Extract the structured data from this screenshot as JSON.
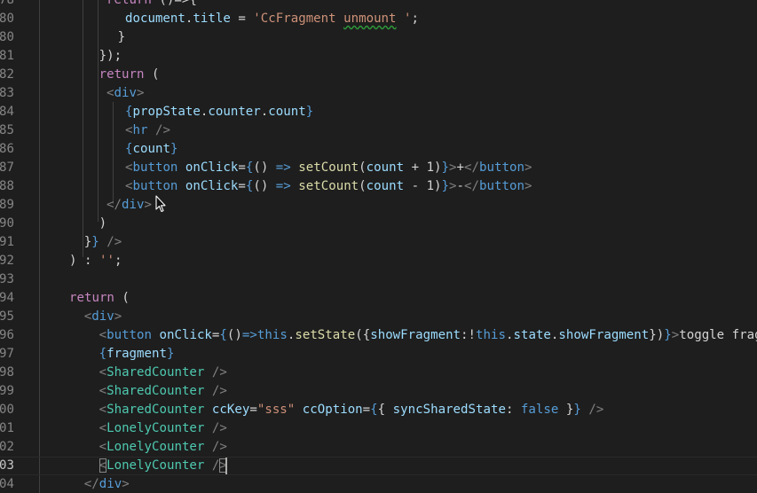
{
  "editor": {
    "theme_colors": {
      "background": "#1e1e1e",
      "line_number": "#858585",
      "keyword": "#c586c0",
      "tag": "#569cd6",
      "component": "#4ec9b0",
      "attribute": "#9cdcfe",
      "function": "#dcdcaa",
      "string": "#ce9178"
    },
    "current_line": "03",
    "lines": [
      {
        "n": "78",
        "indent": 2,
        "tokens": [
          [
            "kw",
            "return"
          ],
          [
            "plain",
            " ()=>{"
          ]
        ]
      },
      {
        "n": "80",
        "indent": 3,
        "tokens": [
          [
            "var",
            "document"
          ],
          [
            "plain",
            "."
          ],
          [
            "var",
            "title"
          ],
          [
            "plain",
            " = "
          ],
          [
            "str",
            "'CcFragment "
          ],
          [
            "str_sq",
            "unmount"
          ],
          [
            "str",
            " '"
          ],
          [
            "plain",
            ";"
          ]
        ]
      },
      {
        "n": "80",
        "indent": 2.6,
        "tokens": [
          [
            "plain",
            "}"
          ]
        ]
      },
      {
        "n": "81",
        "indent": 1.6,
        "tokens": [
          [
            "plain",
            "});"
          ]
        ]
      },
      {
        "n": "82",
        "indent": 1.6,
        "tokens": [
          [
            "kw",
            "return"
          ],
          [
            "plain",
            " ("
          ]
        ]
      },
      {
        "n": "83",
        "indent": 2,
        "tokens": [
          [
            "punct",
            "<"
          ],
          [
            "tag",
            "div"
          ],
          [
            "punct",
            ">"
          ]
        ]
      },
      {
        "n": "84",
        "indent": 3,
        "tokens": [
          [
            "brace",
            "{"
          ],
          [
            "var",
            "propState"
          ],
          [
            "plain",
            "."
          ],
          [
            "var",
            "counter"
          ],
          [
            "plain",
            "."
          ],
          [
            "var",
            "count"
          ],
          [
            "brace",
            "}"
          ]
        ]
      },
      {
        "n": "85",
        "indent": 3,
        "tokens": [
          [
            "punct",
            "<"
          ],
          [
            "tag",
            "hr"
          ],
          [
            "plain",
            " "
          ],
          [
            "punct",
            "/>"
          ]
        ]
      },
      {
        "n": "86",
        "indent": 3,
        "tokens": [
          [
            "brace",
            "{"
          ],
          [
            "var",
            "count"
          ],
          [
            "brace",
            "}"
          ]
        ]
      },
      {
        "n": "87",
        "indent": 3,
        "tokens": [
          [
            "punct",
            "<"
          ],
          [
            "tag",
            "button"
          ],
          [
            "plain",
            " "
          ],
          [
            "attr",
            "onClick"
          ],
          [
            "plain",
            "="
          ],
          [
            "brace",
            "{"
          ],
          [
            "plain",
            "() "
          ],
          [
            "tag",
            "=>"
          ],
          [
            "plain",
            " "
          ],
          [
            "func",
            "setCount"
          ],
          [
            "plain",
            "("
          ],
          [
            "var",
            "count"
          ],
          [
            "plain",
            " + 1)"
          ],
          [
            "brace",
            "}"
          ],
          [
            "punct",
            ">"
          ],
          [
            "plain",
            "+"
          ],
          [
            "punct",
            "</"
          ],
          [
            "tag",
            "button"
          ],
          [
            "punct",
            ">"
          ]
        ]
      },
      {
        "n": "88",
        "indent": 3,
        "tokens": [
          [
            "punct",
            "<"
          ],
          [
            "tag",
            "button"
          ],
          [
            "plain",
            " "
          ],
          [
            "attr",
            "onClick"
          ],
          [
            "plain",
            "="
          ],
          [
            "brace",
            "{"
          ],
          [
            "plain",
            "() "
          ],
          [
            "tag",
            "=>"
          ],
          [
            "plain",
            " "
          ],
          [
            "func",
            "setCount"
          ],
          [
            "plain",
            "("
          ],
          [
            "var",
            "count"
          ],
          [
            "plain",
            " - 1)"
          ],
          [
            "brace",
            "}"
          ],
          [
            "punct",
            ">"
          ],
          [
            "plain",
            "-"
          ],
          [
            "punct",
            "</"
          ],
          [
            "tag",
            "button"
          ],
          [
            "punct",
            ">"
          ]
        ]
      },
      {
        "n": "89",
        "indent": 2,
        "tokens": [
          [
            "punct",
            "</"
          ],
          [
            "tag",
            "div"
          ],
          [
            "punct",
            ">"
          ]
        ]
      },
      {
        "n": "90",
        "indent": 1.6,
        "tokens": [
          [
            "plain",
            ")"
          ]
        ]
      },
      {
        "n": "91",
        "indent": 0.8,
        "tokens": [
          [
            "plain",
            "}"
          ],
          [
            "brace",
            "}"
          ],
          [
            "plain",
            " "
          ],
          [
            "punct",
            "/>"
          ]
        ]
      },
      {
        "n": "92",
        "indent": 0,
        "tokens": [
          [
            "plain",
            ") : "
          ],
          [
            "str",
            "''"
          ],
          [
            "plain",
            ";"
          ]
        ]
      },
      {
        "n": "93",
        "indent": 0,
        "tokens": []
      },
      {
        "n": "94",
        "indent": 0,
        "tokens": [
          [
            "kw",
            "return"
          ],
          [
            "plain",
            " ("
          ]
        ]
      },
      {
        "n": "95",
        "indent": 0.8,
        "tokens": [
          [
            "punct",
            "<"
          ],
          [
            "tag",
            "div"
          ],
          [
            "punct",
            ">"
          ]
        ]
      },
      {
        "n": "96",
        "indent": 1.6,
        "tokens": [
          [
            "punct",
            "<"
          ],
          [
            "tag",
            "button"
          ],
          [
            "plain",
            " "
          ],
          [
            "attr",
            "onClick"
          ],
          [
            "plain",
            "="
          ],
          [
            "brace",
            "{"
          ],
          [
            "plain",
            "()"
          ],
          [
            "tag",
            "=>"
          ],
          [
            "this",
            "this"
          ],
          [
            "plain",
            "."
          ],
          [
            "func",
            "setState"
          ],
          [
            "plain",
            "({"
          ],
          [
            "var",
            "showFragment"
          ],
          [
            "plain",
            ":!"
          ],
          [
            "this",
            "this"
          ],
          [
            "plain",
            "."
          ],
          [
            "var",
            "state"
          ],
          [
            "plain",
            "."
          ],
          [
            "var",
            "showFragment"
          ],
          [
            "plain",
            "})"
          ],
          [
            "brace",
            "}"
          ],
          [
            "punct",
            ">"
          ],
          [
            "plain",
            "toggle fragment"
          ]
        ]
      },
      {
        "n": "97",
        "indent": 1.6,
        "tokens": [
          [
            "brace",
            "{"
          ],
          [
            "var",
            "fragment"
          ],
          [
            "brace",
            "}"
          ]
        ]
      },
      {
        "n": "98",
        "indent": 1.6,
        "tokens": [
          [
            "punct",
            "<"
          ],
          [
            "comp",
            "SharedCounter"
          ],
          [
            "plain",
            " "
          ],
          [
            "punct",
            "/>"
          ]
        ]
      },
      {
        "n": "99",
        "indent": 1.6,
        "tokens": [
          [
            "punct",
            "<"
          ],
          [
            "comp",
            "SharedCounter"
          ],
          [
            "plain",
            " "
          ],
          [
            "punct",
            "/>"
          ]
        ]
      },
      {
        "n": "00",
        "indent": 1.6,
        "tokens": [
          [
            "punct",
            "<"
          ],
          [
            "comp",
            "SharedCounter"
          ],
          [
            "plain",
            " "
          ],
          [
            "attr",
            "ccKey"
          ],
          [
            "plain",
            "="
          ],
          [
            "str",
            "\"sss\""
          ],
          [
            "plain",
            " "
          ],
          [
            "attr",
            "ccOption"
          ],
          [
            "plain",
            "="
          ],
          [
            "brace",
            "{"
          ],
          [
            "plain",
            "{ "
          ],
          [
            "var",
            "syncSharedState"
          ],
          [
            "plain",
            ": "
          ],
          [
            "bool",
            "false"
          ],
          [
            "plain",
            " }"
          ],
          [
            "brace",
            "}"
          ],
          [
            "plain",
            " "
          ],
          [
            "punct",
            "/>"
          ]
        ]
      },
      {
        "n": "01",
        "indent": 1.6,
        "tokens": [
          [
            "punct",
            "<"
          ],
          [
            "comp",
            "LonelyCounter"
          ],
          [
            "plain",
            " "
          ],
          [
            "punct",
            "/>"
          ]
        ]
      },
      {
        "n": "02",
        "indent": 1.6,
        "tokens": [
          [
            "punct",
            "<"
          ],
          [
            "comp",
            "LonelyCounter"
          ],
          [
            "plain",
            " "
          ],
          [
            "punct",
            "/>"
          ]
        ]
      },
      {
        "n": "03",
        "indent": 1.6,
        "tokens": [
          [
            "punct_match",
            "<"
          ],
          [
            "comp",
            "LonelyCounter"
          ],
          [
            "plain",
            " "
          ],
          [
            "punct",
            "/"
          ],
          [
            "punct_match",
            ">"
          ]
        ]
      },
      {
        "n": "04",
        "indent": 0.8,
        "tokens": [
          [
            "punct",
            "</"
          ],
          [
            "tag",
            "div"
          ],
          [
            "punct",
            ">"
          ]
        ]
      }
    ]
  }
}
